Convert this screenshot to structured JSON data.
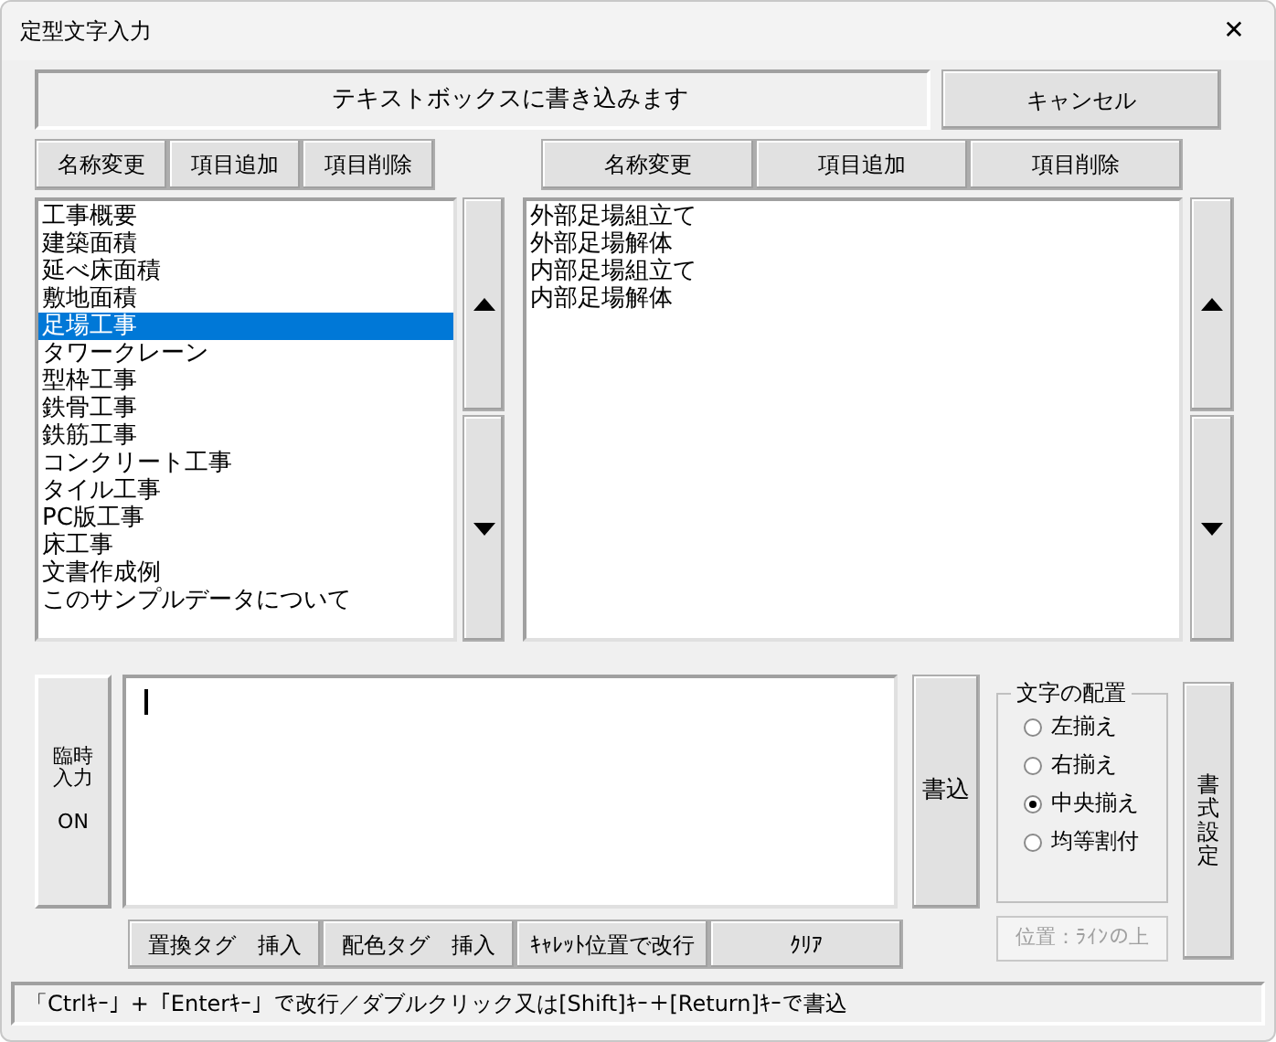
{
  "window": {
    "title": "定型文字入力",
    "close": "✕"
  },
  "header": {
    "message": "テキストボックスに書き込みます",
    "cancel": "キャンセル"
  },
  "left_panel": {
    "buttons": [
      "名称変更",
      "項目追加",
      "項目削除"
    ],
    "items": [
      {
        "label": "工事概要",
        "selected": false
      },
      {
        "label": "建築面積",
        "selected": false
      },
      {
        "label": "延べ床面積",
        "selected": false
      },
      {
        "label": "敷地面積",
        "selected": false
      },
      {
        "label": "足場工事",
        "selected": true
      },
      {
        "label": "タワークレーン",
        "selected": false
      },
      {
        "label": "型枠工事",
        "selected": false
      },
      {
        "label": "鉄骨工事",
        "selected": false
      },
      {
        "label": "鉄筋工事",
        "selected": false
      },
      {
        "label": "コンクリート工事",
        "selected": false
      },
      {
        "label": "タイル工事",
        "selected": false
      },
      {
        "label": "PC版工事",
        "selected": false
      },
      {
        "label": "床工事",
        "selected": false
      },
      {
        "label": "文書作成例",
        "selected": false
      },
      {
        "label": "このサンプルデータについて",
        "selected": false
      }
    ]
  },
  "right_panel": {
    "buttons": [
      "名称変更",
      "項目追加",
      "項目削除"
    ],
    "items": [
      {
        "label": "外部足場組立て",
        "selected": false
      },
      {
        "label": "外部足場解体",
        "selected": false
      },
      {
        "label": "内部足場組立て",
        "selected": false
      },
      {
        "label": "内部足場解体",
        "selected": false
      }
    ]
  },
  "editor": {
    "toggle_label": "臨時入力",
    "toggle_state": "ON",
    "write_button": "書込",
    "insert_buttons": [
      "置換タグ　挿入",
      "配色タグ　挿入",
      "ｷｬﾚｯﾄ位置で改行",
      "ｸﾘｱ"
    ]
  },
  "alignment": {
    "title": "文字の配置",
    "options": [
      {
        "label": "左揃え",
        "selected": false
      },
      {
        "label": "右揃え",
        "selected": false
      },
      {
        "label": "中央揃え",
        "selected": true
      },
      {
        "label": "均等割付",
        "selected": false
      }
    ],
    "position": {
      "value": "位置：ﾗｲﾝの上",
      "disabled": true
    }
  },
  "format_button": "書式設定",
  "status_bar": "「Ctrlｷｰ」+「Enterｷｰ」で改行／ダブルクリック又は[Shift]ｷｰ＋[Return]ｷｰで書込"
}
